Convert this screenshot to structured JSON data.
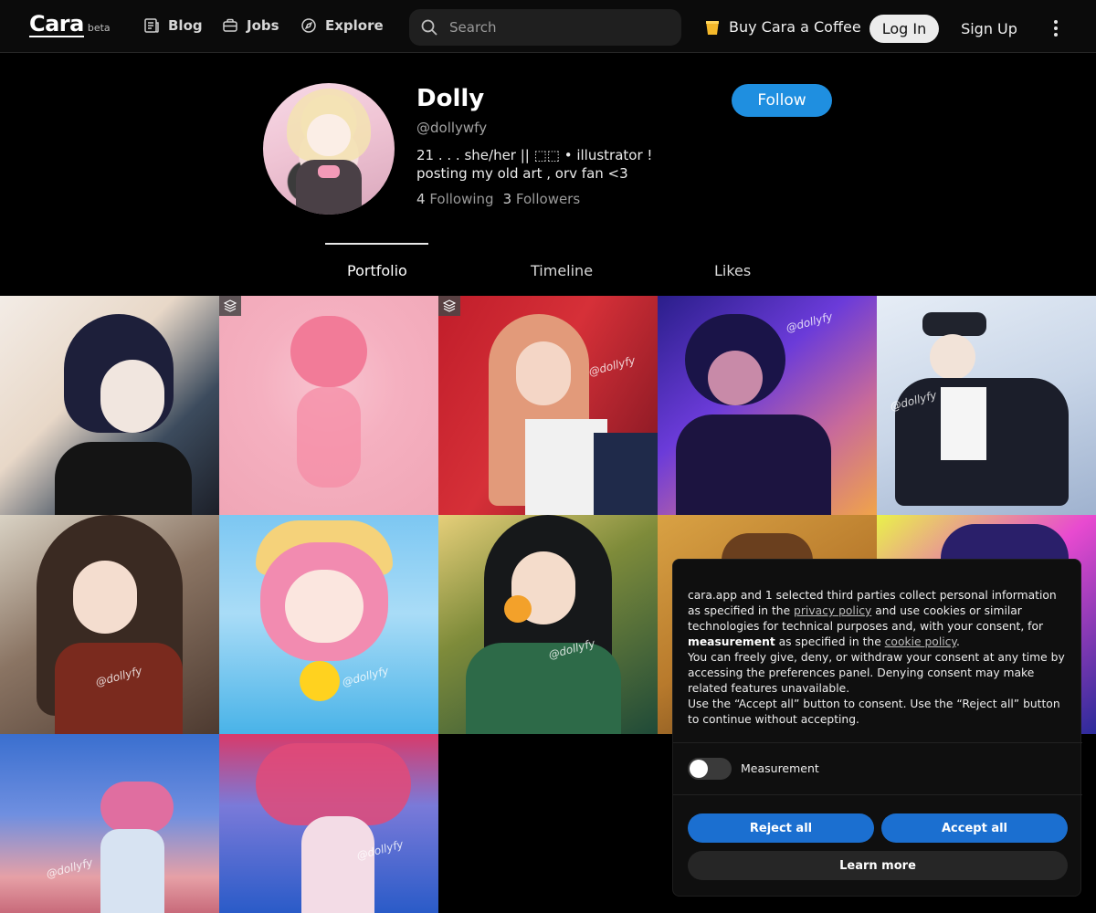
{
  "nav": {
    "logo": "Cara",
    "logo_badge": "beta",
    "links": [
      {
        "label": "Blog",
        "icon": "newspaper-icon"
      },
      {
        "label": "Jobs",
        "icon": "briefcase-icon"
      },
      {
        "label": "Explore",
        "icon": "compass-icon"
      }
    ],
    "search_placeholder": "Search",
    "coffee_label": "Buy Cara a Coffee",
    "login_label": "Log In",
    "signup_label": "Sign Up"
  },
  "profile": {
    "name": "Dolly",
    "handle": "@dollywfy",
    "bio_line1": "21 . . . she/her || ⬚⬚ • illustrator !",
    "bio_line2": "posting my old art , orv fan <3",
    "following_count": "4",
    "following_label": "Following",
    "followers_count": "3",
    "followers_label": "Followers",
    "follow_label": "Follow"
  },
  "tabs": [
    {
      "label": "Portfolio",
      "active": true
    },
    {
      "label": "Timeline",
      "active": false
    },
    {
      "label": "Likes",
      "active": false
    }
  ],
  "signature": "@dollyfy",
  "consent": {
    "p1_a": "cara.app and 1 selected third parties collect personal information as specified in the ",
    "privacy_link": "privacy policy",
    "p1_b": " and use cookies or similar technologies for technical purposes and, with your consent, for ",
    "p1_bold": "measurement",
    "p1_c": " as specified in the ",
    "cookie_link": "cookie policy",
    "p1_d": ".",
    "p2": "You can freely give, deny, or withdraw your consent at any time by accessing the preferences panel. Denying consent may make related features unavailable.",
    "p3": "Use the “Accept all” button to consent. Use the “Reject all” button to continue without accepting.",
    "toggle_label": "Measurement",
    "reject_label": "Reject all",
    "accept_label": "Accept all",
    "learn_label": "Learn more"
  },
  "colors": {
    "accent": "#1f8fe0",
    "consent_button": "#1b6fd0",
    "background": "#000000"
  }
}
